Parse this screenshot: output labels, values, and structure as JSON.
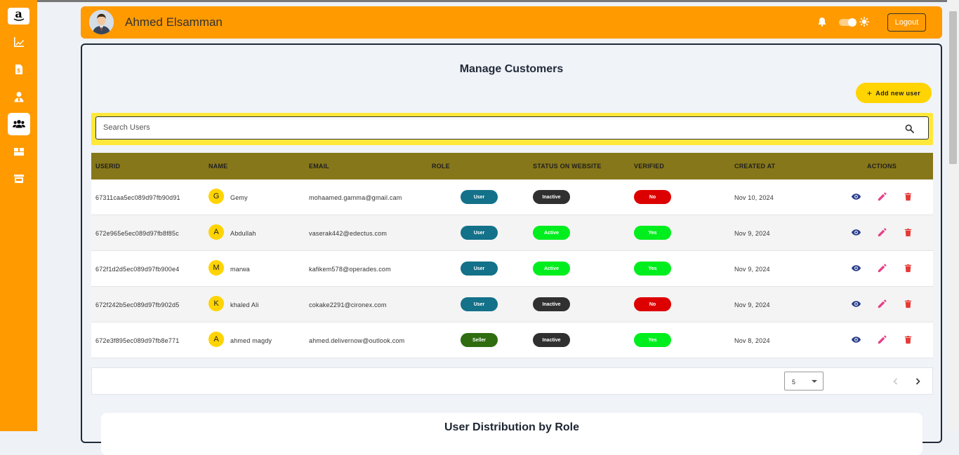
{
  "sidebar": {
    "logo_text": "a",
    "items": [
      {
        "icon": "chart-line-icon"
      },
      {
        "icon": "invoice-icon"
      },
      {
        "icon": "user-tie-icon"
      },
      {
        "icon": "users-icon",
        "active": true
      },
      {
        "icon": "boxes-icon"
      },
      {
        "icon": "store-icon"
      }
    ]
  },
  "header": {
    "user_name": "Ahmed Elsamman",
    "logout_label": "Logout"
  },
  "main": {
    "title": "Manage Customers",
    "add_button_label": "Add new user",
    "search_placeholder": "Search Users",
    "columns": [
      "USERID",
      "NAME",
      "EMAIL",
      "ROLE",
      "STATUS ON WEBSITE",
      "VERIFIED",
      "CREATED AT",
      "ACTIONS"
    ],
    "rows": [
      {
        "userid": "67311caa5ec089d97fb90d91",
        "initial": "G",
        "name": "Gemy",
        "email": "mohaamed.gamma@gmail.cam",
        "role": "User",
        "status": "Inactive",
        "verified": "No",
        "created": "Nov 10, 2024"
      },
      {
        "userid": "672e965e5ec089d97fb8f85c",
        "initial": "A",
        "name": "Abdullah",
        "email": "vaserak442@edectus.com",
        "role": "User",
        "status": "Active",
        "verified": "Yes",
        "created": "Nov 9, 2024"
      },
      {
        "userid": "672f1d2d5ec089d97fb900e4",
        "initial": "M",
        "name": "marwa",
        "email": "kafikem578@operades.com",
        "role": "User",
        "status": "Active",
        "verified": "Yes",
        "created": "Nov 9, 2024"
      },
      {
        "userid": "672f242b5ec089d97fb902d5",
        "initial": "K",
        "name": "khaled Ali",
        "email": "cokake2291@cironex.com",
        "role": "User",
        "status": "Inactive",
        "verified": "No",
        "created": "Nov 9, 2024"
      },
      {
        "userid": "672e3f895ec089d97fb8e771",
        "initial": "A",
        "name": "ahmed magdy",
        "email": "ahmed.delivernow@outlook.com",
        "role": "Seller",
        "status": "Inactive",
        "verified": "Yes",
        "created": "Nov 8, 2024"
      }
    ],
    "rows_per_page": "5",
    "chart_title": "User Distribution by Role"
  },
  "colors": {
    "accent_orange": "#ff9a00",
    "table_header": "#86771a",
    "role_user": "#137189",
    "role_seller": "#2f6d10",
    "status_active": "#00ee1e",
    "status_inactive": "#303030",
    "verified_yes": "#00ee1e",
    "verified_no": "#dd0000",
    "view_icon": "#2a3f8a",
    "edit_icon": "#e83f86",
    "delete_icon": "#e53935"
  }
}
